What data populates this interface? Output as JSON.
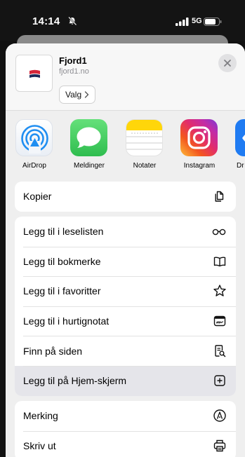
{
  "status_bar": {
    "time": "14:14",
    "network": "5G"
  },
  "header": {
    "site_name": "Fjord1",
    "site_url": "fjord1.no",
    "options_label": "Valg",
    "brand_colors": {
      "logo_red": "#d6263a",
      "logo_navy": "#1d2b5c"
    }
  },
  "apps": [
    {
      "label": "AirDrop",
      "icon": "airdrop-icon"
    },
    {
      "label": "Meldinger",
      "icon": "messages-icon"
    },
    {
      "label": "Notater",
      "icon": "notes-icon"
    },
    {
      "label": "Instagram",
      "icon": "instagram-icon"
    },
    {
      "label": "Dr",
      "icon": "drive-icon"
    }
  ],
  "actions": {
    "group1": [
      {
        "label": "Kopier",
        "icon": "copy-icon"
      }
    ],
    "group2": [
      {
        "label": "Legg til i leselisten",
        "icon": "glasses-icon"
      },
      {
        "label": "Legg til bokmerke",
        "icon": "book-icon"
      },
      {
        "label": "Legg til i favoritter",
        "icon": "star-icon"
      },
      {
        "label": "Legg til i hurtignotat",
        "icon": "quick-note-icon"
      },
      {
        "label": "Finn på siden",
        "icon": "find-in-page-icon"
      },
      {
        "label": "Legg til på Hjem-skjerm",
        "icon": "add-square-icon",
        "highlighted": true
      }
    ],
    "group3": [
      {
        "label": "Merking",
        "icon": "markup-icon"
      },
      {
        "label": "Skriv ut",
        "icon": "printer-icon"
      }
    ]
  },
  "colors": {
    "accent_blue": "#1f8ef1",
    "messages_green": "#34c759",
    "notes_yellow": "#ffd60a"
  }
}
